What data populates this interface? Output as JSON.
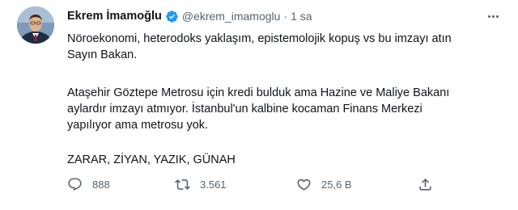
{
  "author": {
    "name": "Ekrem İmamoğlu",
    "handle": "@ekrem_imamoglu",
    "separator": "·",
    "time": "1 sa",
    "verified": true
  },
  "text": {
    "line1": "Nöroekonomi, heterodoks yaklaşım, epistemolojik kopuş vs bu imzayı atın",
    "line2": "Sayın Bakan.",
    "line3": "Ataşehir Göztepe Metrosu için kredi bulduk ama Hazine ve Maliye Bakanı",
    "line4": "aylardır imzayı atmıyor. İstanbul'un kalbine kocaman Finans Merkezi",
    "line5": "yapılıyor ama metrosu yok.",
    "line6": "ZARAR, ZİYAN, YAZIK, GÜNAH"
  },
  "actions": {
    "replies": "888",
    "retweets": "3.561",
    "likes": "25,6 B"
  },
  "icons": {
    "verified": "verified-badge-icon",
    "more": "more-icon",
    "reply": "reply-icon",
    "retweet": "retweet-icon",
    "like": "like-icon",
    "share": "share-icon"
  },
  "colors": {
    "text": "#0f1419",
    "secondary": "#536471",
    "verified": "#1d9bf0"
  }
}
